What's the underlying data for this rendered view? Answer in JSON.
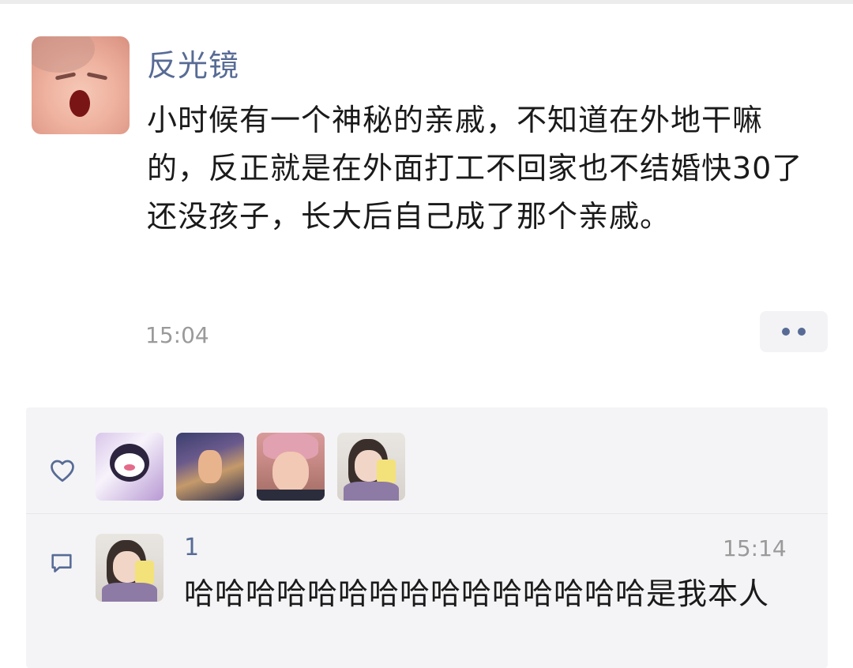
{
  "post": {
    "author": "反光镜",
    "text": "小时候有一个神秘的亲戚，不知道在外地干嘛的，反正就是在外面打工不回家也不结婚快30了还没孩子，长大后自己成了那个亲戚。",
    "time": "15:04",
    "avatar_icon": "baby-avatar"
  },
  "likes": {
    "icon": "heart-icon",
    "avatars": [
      "kuromi-avatar",
      "anime-avatar",
      "pink-hair-avatar",
      "girl-with-drink-avatar"
    ]
  },
  "comments": [
    {
      "name": "1",
      "time": "15:14",
      "text": "哈哈哈哈哈哈哈哈哈哈哈哈哈哈哈是我本人",
      "avatar_icon": "girl-with-drink-avatar"
    }
  ],
  "colors": {
    "name_blue": "#576b95",
    "panel_bg": "#f4f4f6",
    "time_gray": "#9a9a9a"
  }
}
